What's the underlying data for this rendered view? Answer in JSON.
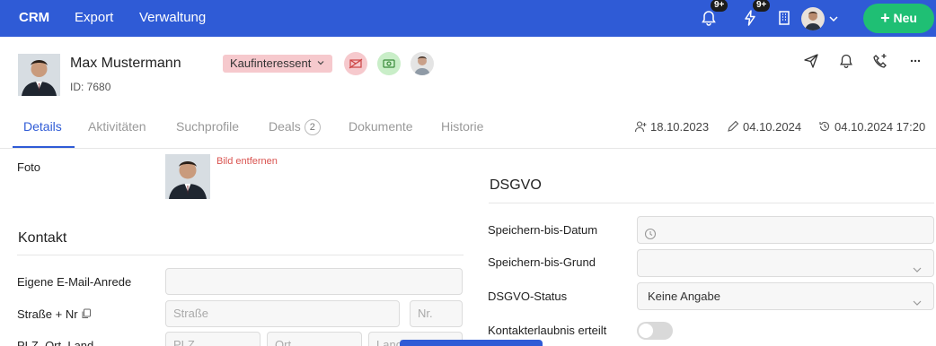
{
  "nav": {
    "items": [
      "CRM",
      "Export",
      "Verwaltung"
    ],
    "badges": [
      "9+",
      "9+"
    ],
    "new_button": "Neu"
  },
  "profile": {
    "name": "Max Mustermann",
    "id": "ID: 7680",
    "status": "Kaufinteressent"
  },
  "tabs": [
    {
      "label": "Details"
    },
    {
      "label": "Aktivitäten"
    },
    {
      "label": "Suchprofile"
    },
    {
      "label": "Deals",
      "count": "2"
    },
    {
      "label": "Dokumente"
    },
    {
      "label": "Historie"
    }
  ],
  "meta": {
    "created": "18.10.2023",
    "edited": "04.10.2024",
    "last_activity": "04.10.2024 17:20"
  },
  "left": {
    "photo_label": "Foto",
    "remove_image": "Bild entfernen",
    "contact_title": "Kontakt",
    "email_salutation_label": "Eigene E-Mail-Anrede",
    "street_label": "Straße + Nr",
    "street_placeholder": "Straße",
    "number_placeholder": "Nr.",
    "plz_label": "PLZ, Ort, Land",
    "plz_placeholder": "PLZ",
    "city_placeholder": "Ort",
    "country_placeholder": "Land"
  },
  "right": {
    "dsgvo_title": "DSGVO",
    "store_until_date_label": "Speichern-bis-Datum",
    "store_until_reason_label": "Speichern-bis-Grund",
    "status_label": "DSGVO-Status",
    "status_value": "Keine Angabe",
    "consent_label": "Kontakterlaubnis erteilt"
  },
  "icons": [
    "bell-icon",
    "lightning-icon",
    "building-icon",
    "chevron-down-icon",
    "plus-icon",
    "no-mail-icon",
    "money-icon",
    "send-icon",
    "phone-icon",
    "more-icon",
    "add-user-icon",
    "pencil-icon",
    "history-icon",
    "copy-icon",
    "clock-icon"
  ],
  "colors": {
    "primary": "#2f5bd6",
    "success": "#1fbf74",
    "status_pill": "#f6c9cd",
    "danger_text": "#d9534f"
  }
}
